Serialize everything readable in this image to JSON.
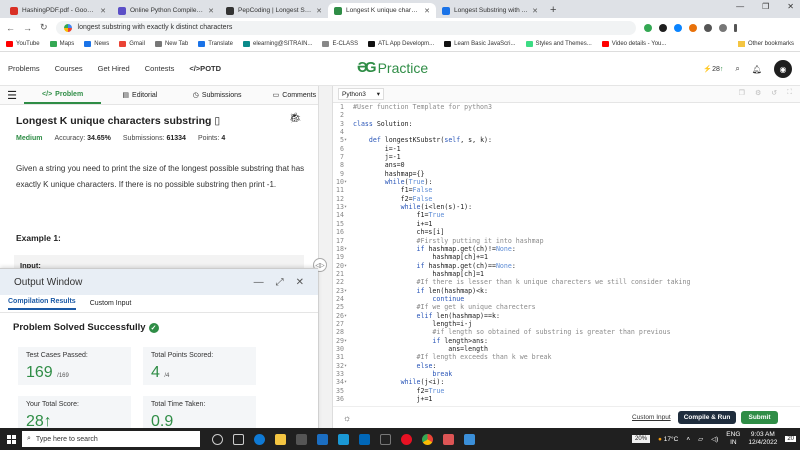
{
  "browser": {
    "tabs": [
      {
        "title": "HashingPDF.pdf - Google D",
        "color": "#d93025"
      },
      {
        "title": "Online Python Compiler - (",
        "color": "#5b4fc7"
      },
      {
        "title": "PepCoding | Longest Substri",
        "color": "#333333"
      },
      {
        "title": "Longest K unique characte",
        "color": "#2f8d46",
        "active": true
      },
      {
        "title": "Longest Substring with At l",
        "color": "#1a73e8"
      }
    ],
    "address": "longest substring with exactly k distinct characters",
    "bookmarks": [
      {
        "label": "YouTube",
        "color": "#ff0000"
      },
      {
        "label": "Maps",
        "color": "#34a853"
      },
      {
        "label": "News",
        "color": "#1a73e8"
      },
      {
        "label": "Gmail",
        "color": "#ea4335"
      },
      {
        "label": "New Tab",
        "color": "#777777"
      },
      {
        "label": "Translate",
        "color": "#1a73e8"
      },
      {
        "label": "elearning@SITRAIN...",
        "color": "#0a8a8a"
      },
      {
        "label": "E-CLASS",
        "color": "#888888"
      },
      {
        "label": "ATL App Developm...",
        "color": "#111111"
      },
      {
        "label": "Learn Basic JavaScri...",
        "color": "#111111"
      },
      {
        "label": "Styles and Themes...",
        "color": "#3ddc84"
      },
      {
        "label": "Video details - You...",
        "color": "#ff0000"
      }
    ],
    "other_bookmarks": "Other bookmarks"
  },
  "site": {
    "nav": [
      "Problems",
      "Courses",
      "Get Hired",
      "Contests",
      "</>POTD"
    ],
    "logo": "Practice",
    "streak": "28"
  },
  "problem_tabs": [
    "Problem",
    "Editorial",
    "Submissions",
    "Comments"
  ],
  "problem": {
    "title": "Longest K unique characters substring",
    "difficulty": "Medium",
    "accuracy_label": "Accuracy:",
    "accuracy": "34.65%",
    "submissions_label": "Submissions:",
    "submissions": "61334",
    "points_label": "Points:",
    "points": "4",
    "description": "Given a string you need to print the size of the longest possible substring that has exactly K unique characters. If there is no possible substring then print -1.",
    "example_heading": "Example 1:",
    "input_label": "Input:"
  },
  "output": {
    "title": "Output Window",
    "tabs": [
      "Compilation Results",
      "Custom Input"
    ],
    "status": "Problem Solved Successfully",
    "cards": [
      {
        "label": "Test Cases Passed:",
        "value": "169",
        "total": "/169"
      },
      {
        "label": "Total Points Scored:",
        "value": "4",
        "total": "/4"
      },
      {
        "label": "Your Total Score:",
        "value": "28↑",
        "total": ""
      },
      {
        "label": "Total Time Taken:",
        "value": "0.9",
        "total": ""
      }
    ]
  },
  "editor": {
    "language": "Python3",
    "lines": [
      "#User function Template for python3",
      "",
      "class Solution:",
      "",
      "    def longestKSubstr(self, s, k):",
      "        i=-1",
      "        j=-1",
      "        ans=0",
      "        hashmap={}",
      "        while(True):",
      "            f1=False",
      "            f2=False",
      "            while(i<len(s)-1):",
      "                f1=True",
      "                i+=1",
      "                ch=s[i]",
      "                #Firstly putting it into hashmap",
      "                if hashmap.get(ch)!=None:",
      "                    hashmap[ch]+=1",
      "                if hashmap.get(ch)==None:",
      "                    hashmap[ch]=1",
      "                #If there is lesser than k unique charecters we still consider taking",
      "                if len(hashmap)<k:",
      "                    continue",
      "                #If we get k unique charecters",
      "                elif len(hashmap)==k:",
      "                    length=i-j",
      "                    #if length so obtained of substring is greater than previous",
      "                    if length>ans:",
      "                        ans=length",
      "                #If length exceeds than k we break",
      "                else:",
      "                    break",
      "            while(j<i):",
      "                f2=True",
      "                j+=1"
    ],
    "folds": [
      5,
      10,
      13,
      18,
      20,
      23,
      26,
      29,
      32,
      34
    ],
    "custom_input": "Custom Input",
    "compile_label": "Compile & Run",
    "submit_label": "Submit"
  },
  "taskbar": {
    "search_placeholder": "Type here to search",
    "battery": "20%",
    "weather": "17°C",
    "lang": "ENG",
    "region": "IN",
    "time": "9:03 AM",
    "date": "12/4/2022",
    "notifications": "20"
  }
}
